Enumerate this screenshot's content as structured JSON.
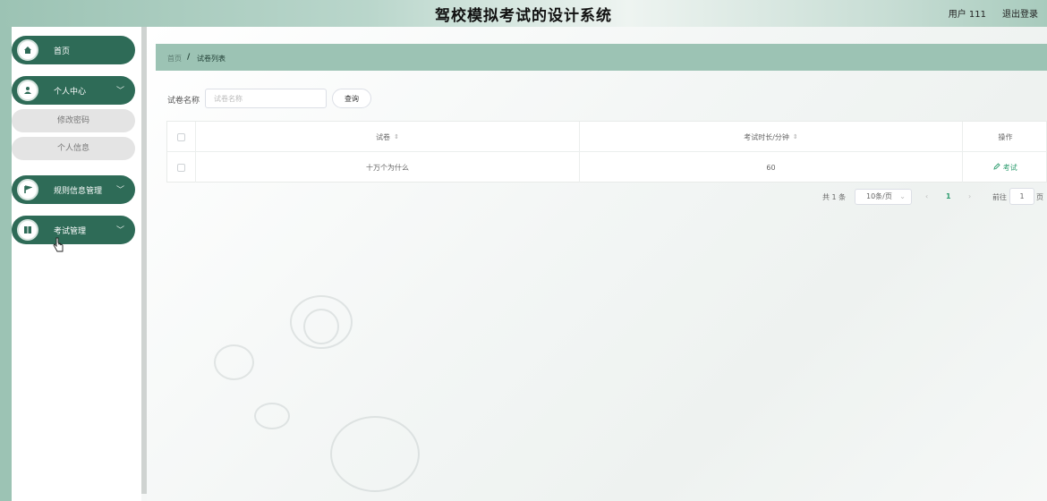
{
  "header": {
    "title": "驾校模拟考试的设计系统",
    "user": "用户 111",
    "logout": "退出登录"
  },
  "sidebar": {
    "menus": [
      {
        "label": "首页",
        "icon": "home-icon"
      },
      {
        "label": "个人中心",
        "icon": "user-icon",
        "chevron": "﹀"
      },
      {
        "label": "规则信息管理",
        "icon": "flag-icon",
        "chevron": "﹀"
      },
      {
        "label": "考试管理",
        "icon": "grid-icon",
        "chevron": "﹀"
      }
    ],
    "submenus": [
      {
        "label": "修改密码"
      },
      {
        "label": "个人信息"
      }
    ]
  },
  "breadcrumb": {
    "home": "首页",
    "separator": "/",
    "current": "试卷列表"
  },
  "search": {
    "label": "试卷名称",
    "placeholder": "试卷名称",
    "button": "查询"
  },
  "table": {
    "headers": [
      "试卷",
      "考试时长/分钟",
      "操作"
    ],
    "sort_icon": "⇕",
    "rows": [
      {
        "name": "十万个为什么",
        "duration": "60",
        "action": "考试"
      }
    ]
  },
  "pagination": {
    "total": "共 1 条",
    "page_size": "10条/页",
    "current_page": "1",
    "goto_label": "前往",
    "goto_value": "1",
    "page_suffix": "页",
    "prev": "‹",
    "next": "›",
    "dropdown": "⌄"
  },
  "colors": {
    "sidebar_active": "#2e6b57",
    "accent": "#9cc3b4",
    "link": "#2e9d6f"
  }
}
